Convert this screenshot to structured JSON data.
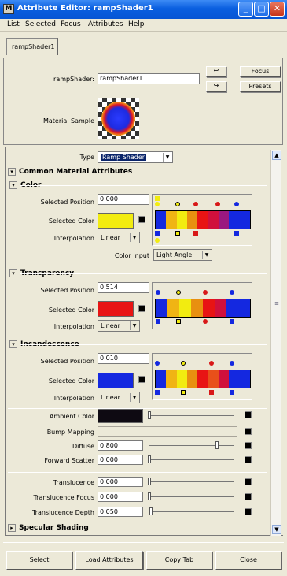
{
  "window": {
    "title": "Attribute Editor: rampShader1",
    "icon_text": "M",
    "minimize": "_",
    "maximize": "□",
    "close": "✕"
  },
  "menu": [
    "List",
    "Selected",
    "Focus",
    "Attributes",
    "Help"
  ],
  "tab": "rampShader1",
  "header": {
    "shader_label": "rampShader:",
    "shader_value": "rampShader1",
    "focus_label": "Focus",
    "presets_label": "Presets",
    "material_sample_label": "Material Sample"
  },
  "type": {
    "label": "Type",
    "value": "Ramp Shader"
  },
  "sections": {
    "common": "Common Material Attributes",
    "color": "Color",
    "transparency": "Transparency",
    "incandescence": "Incandescence",
    "specular": "Specular Shading"
  },
  "color": {
    "selected_position_label": "Selected Position",
    "selected_position": "0.000",
    "selected_color_label": "Selected Color",
    "interpolation_label": "Interpolation",
    "interpolation": "Linear",
    "color_input_label": "Color Input",
    "color_input": "Light Angle",
    "swatch": "#f2ec10"
  },
  "transparency": {
    "selected_position_label": "Selected Position",
    "selected_position": "0.514",
    "selected_color_label": "Selected Color",
    "interpolation_label": "Interpolation",
    "interpolation": "Linear",
    "swatch": "#e81414"
  },
  "incandescence": {
    "selected_position_label": "Selected Position",
    "selected_position": "0.010",
    "selected_color_label": "Selected Color",
    "interpolation_label": "Interpolation",
    "interpolation": "Linear",
    "swatch": "#1428e0"
  },
  "attrs": {
    "ambient_label": "Ambient Color",
    "bump_label": "Bump Mapping",
    "diffuse_label": "Diffuse",
    "diffuse": "0.800",
    "forward_label": "Forward Scatter",
    "forward": "0.000",
    "translucence_label": "Translucence",
    "translucence": "0.000",
    "trans_focus_label": "Translucence Focus",
    "trans_focus": "0.000",
    "trans_depth_label": "Translucence Depth",
    "trans_depth": "0.050"
  },
  "buttons": {
    "select": "Select",
    "load": "Load Attributes",
    "copy": "Copy Tab",
    "close": "Close"
  }
}
